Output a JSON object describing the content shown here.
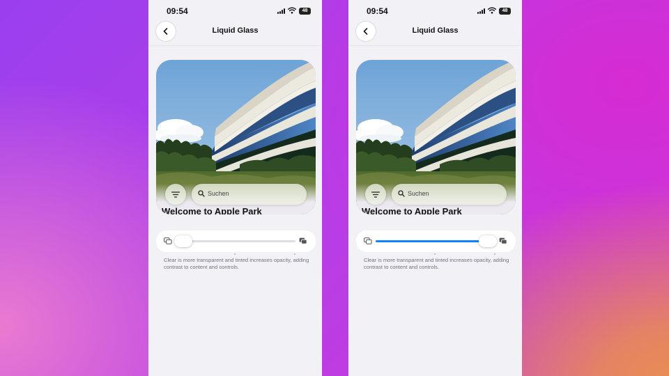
{
  "phones": [
    {
      "status": {
        "time": "09:54",
        "battery": "48"
      },
      "nav": {
        "title": "Liquid Glass"
      },
      "card": {
        "heading": "Welcome to Apple Park"
      },
      "search": {
        "placeholder": "Suchen"
      },
      "slider": {
        "value": 0.0,
        "value_description": "Clear"
      },
      "description": "Clear is more transparent and tinted increases opacity, adding contrast to content and controls."
    },
    {
      "status": {
        "time": "09:54",
        "battery": "48"
      },
      "nav": {
        "title": "Liquid Glass"
      },
      "card": {
        "heading": "Welcome to Apple Park"
      },
      "search": {
        "placeholder": "Suchen"
      },
      "slider": {
        "value": 1.0,
        "value_description": "Tinted"
      },
      "description": "Clear is more transparent and tinted increases opacity, adding contrast to content and controls."
    }
  ],
  "icons": {
    "back": "chevron-left-icon",
    "filter": "filter-lines-icon",
    "search": "magnifying-glass-icon",
    "slider_min": "clear-glass-icon",
    "slider_max": "tinted-glass-icon"
  },
  "colors": {
    "accent": "#0a84ff",
    "screen_background": "#f2f1f6",
    "control_background": "#ffffff",
    "secondary_text": "#74737a"
  }
}
